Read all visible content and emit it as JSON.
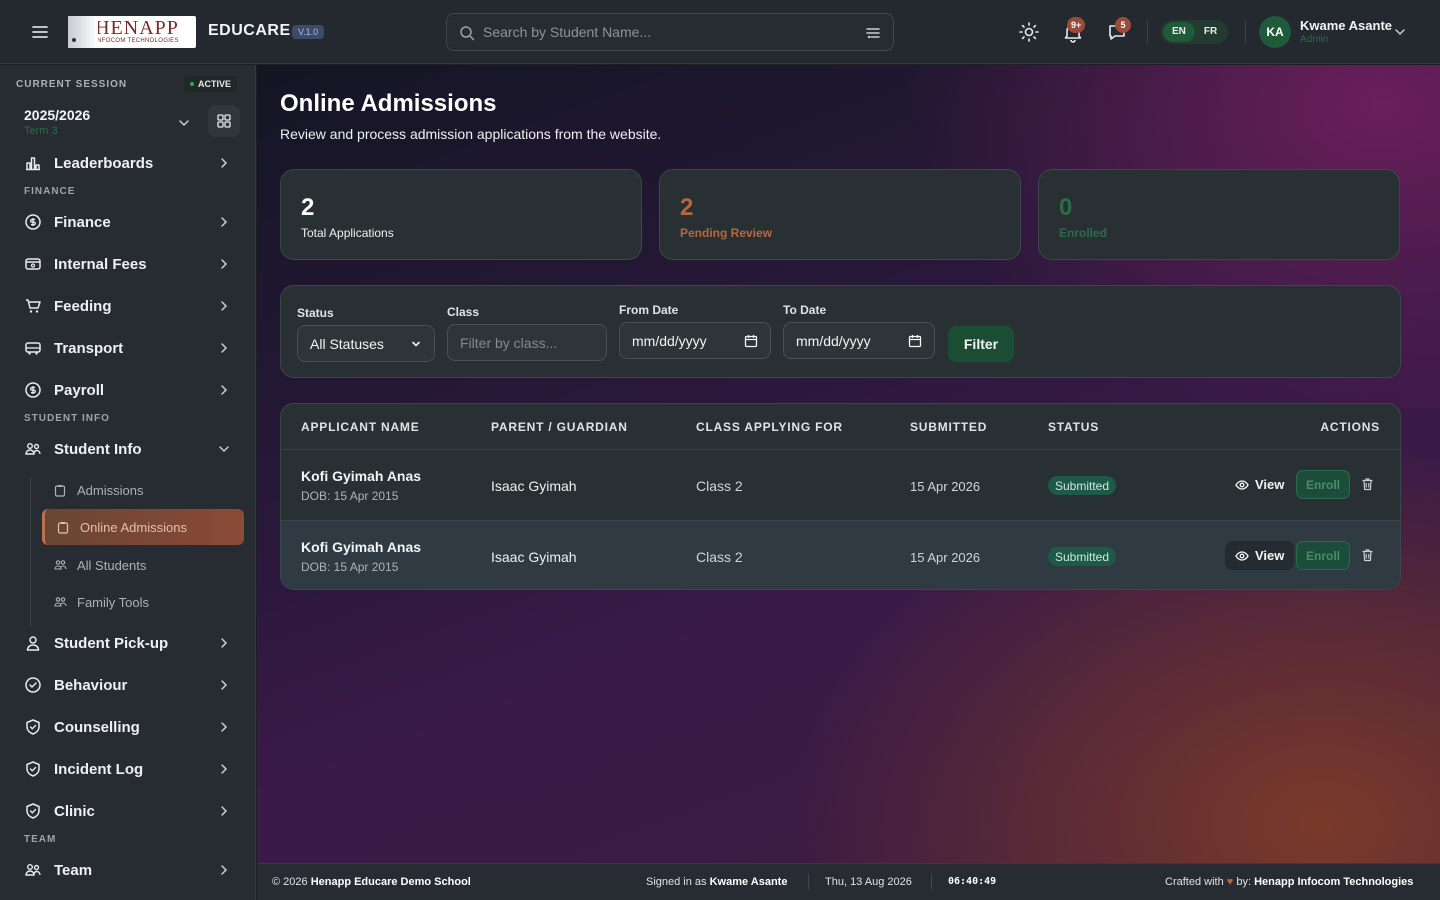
{
  "header": {
    "logo_text": "HENAPP",
    "logo_subtext": "INFOCOM TECHNOLOGIES",
    "app_name": "EDUCARE",
    "version": "V.1.0",
    "search_placeholder": "Search by Student Name...",
    "notifications_count": "9+",
    "messages_count": "5",
    "languages": [
      "EN",
      "FR"
    ],
    "user_initials": "KA",
    "user_name": "Kwame Asante",
    "user_role": "Admin"
  },
  "session": {
    "label": "CURRENT SESSION",
    "status": "ACTIVE",
    "year": "2025/2026",
    "term": "Term 3"
  },
  "sidebar": {
    "items": [
      {
        "label": "Leaderboards"
      },
      {
        "section": "FINANCE"
      },
      {
        "label": "Finance"
      },
      {
        "label": "Internal Fees"
      },
      {
        "label": "Feeding"
      },
      {
        "label": "Transport"
      },
      {
        "label": "Payroll"
      },
      {
        "section": "STUDENT INFO"
      },
      {
        "label": "Student Info"
      },
      {
        "label": "Admissions"
      },
      {
        "label": "Online Admissions"
      },
      {
        "label": "All Students"
      },
      {
        "label": "Family Tools"
      },
      {
        "label": "Student Pick-up"
      },
      {
        "label": "Behaviour"
      },
      {
        "label": "Counselling"
      },
      {
        "label": "Incident Log"
      },
      {
        "label": "Clinic"
      },
      {
        "section": "TEAM"
      },
      {
        "label": "Team"
      }
    ]
  },
  "page": {
    "title": "Online Admissions",
    "subtitle": "Review and process admission applications from the website."
  },
  "stats": [
    {
      "value": "2",
      "label": "Total Applications",
      "color": "#ffffff"
    },
    {
      "value": "2",
      "label": "Pending Review",
      "color": "#b5683f"
    },
    {
      "value": "0",
      "label": "Enrolled",
      "color": "#2c6b4a"
    }
  ],
  "filters": {
    "status_label": "Status",
    "status_value": "All Statuses",
    "class_label": "Class",
    "class_placeholder": "Filter by class...",
    "from_label": "From Date",
    "from_value": "mm/dd/yyyy",
    "to_label": "To Date",
    "to_value": "mm/dd/yyyy",
    "filter_button": "Filter"
  },
  "table": {
    "headers": [
      "APPLICANT NAME",
      "PARENT / GUARDIAN",
      "CLASS APPLYING FOR",
      "SUBMITTED",
      "STATUS",
      "ACTIONS"
    ],
    "rows": [
      {
        "name": "Kofi Gyimah Anas",
        "dob": "DOB: 15 Apr 2015",
        "parent": "Isaac Gyimah",
        "class": "Class 2",
        "submitted": "15 Apr 2026",
        "status": "Submitted",
        "view": "View",
        "enroll": "Enroll"
      },
      {
        "name": "Kofi Gyimah Anas",
        "dob": "DOB: 15 Apr 2015",
        "parent": "Isaac Gyimah",
        "class": "Class 2",
        "submitted": "15 Apr 2026",
        "status": "Submitted",
        "view": "View",
        "enroll": "Enroll"
      }
    ]
  },
  "footer": {
    "copyright": "© 2026",
    "school": "Henapp Educare Demo School",
    "signed_in_label": "Signed in as",
    "signed_in_user": "Kwame Asante",
    "date": "Thu, 13 Aug 2026",
    "time": "06:40:49",
    "crafted_prefix": "Crafted with",
    "crafted_by": "by:",
    "company": "Henapp Infocom Technologies"
  },
  "colors": {
    "accent_green": "#1b4d34",
    "pending_orange": "#b5683f",
    "enrolled_green": "#2c6b4a"
  }
}
